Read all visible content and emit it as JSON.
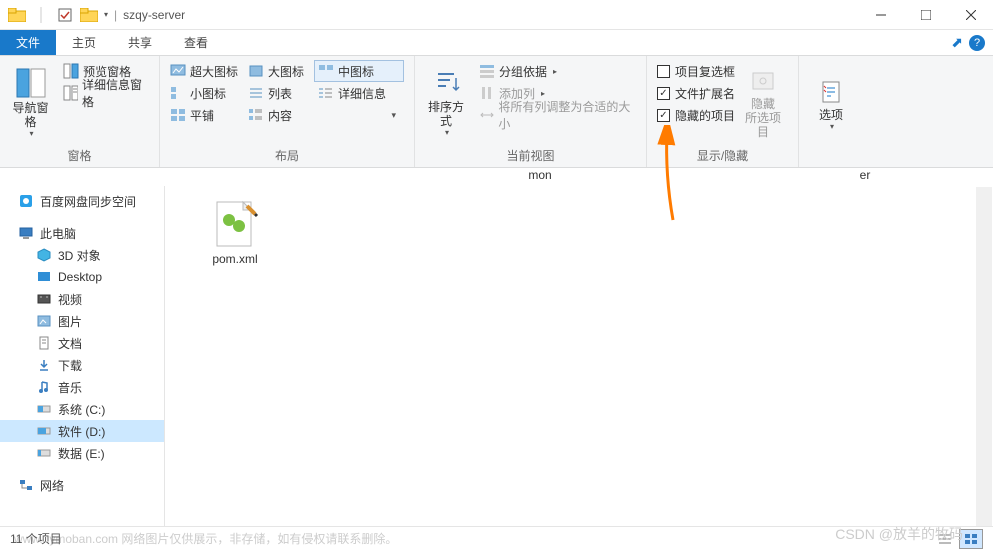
{
  "window": {
    "title": "szqy-server",
    "separator": "|"
  },
  "tabs": {
    "file": "文件",
    "home": "主页",
    "share": "共享",
    "view": "查看"
  },
  "ribbon": {
    "group_pane": {
      "label": "窗格",
      "nav_pane": "导航窗格",
      "preview_pane": "预览窗格",
      "details_pane": "详细信息窗格"
    },
    "group_layout": {
      "label": "布局",
      "extra_large": "超大图标",
      "large": "大图标",
      "medium": "中图标",
      "small": "小图标",
      "list": "列表",
      "details": "详细信息",
      "tiles": "平铺",
      "content": "内容"
    },
    "group_current_view": {
      "label": "当前视图",
      "sort_by": "排序方式",
      "group_by": "分组依据",
      "add_columns": "添加列",
      "size_columns": "将所有列调整为合适的大小"
    },
    "group_show_hide": {
      "label": "显示/隐藏",
      "item_checkboxes": "项目复选框",
      "file_ext": "文件扩展名",
      "hidden_items": "隐藏的项目",
      "hide_selected": "隐藏",
      "hide_selected_sub": "所选项目"
    },
    "group_options": {
      "options": "选项"
    }
  },
  "mystery": {
    "a": "mon",
    "b": "er"
  },
  "nav": {
    "baidu": "百度网盘同步空间",
    "this_pc": "此电脑",
    "obj3d": "3D 对象",
    "desktop": "Desktop",
    "videos": "视频",
    "pictures": "图片",
    "documents": "文档",
    "downloads": "下载",
    "music": "音乐",
    "sys_c": "系统 (C:)",
    "soft_d": "软件 (D:)",
    "data_e": "数据 (E:)",
    "network": "网络"
  },
  "content": {
    "files": [
      {
        "name": "pom.xml"
      }
    ]
  },
  "status": {
    "count": "11 个项目"
  },
  "watermark1": "www...ymoban.com  网络图片仅供展示，非存储，如有侵权请联系删除。",
  "watermark2": "CSDN @放羊的牧码"
}
